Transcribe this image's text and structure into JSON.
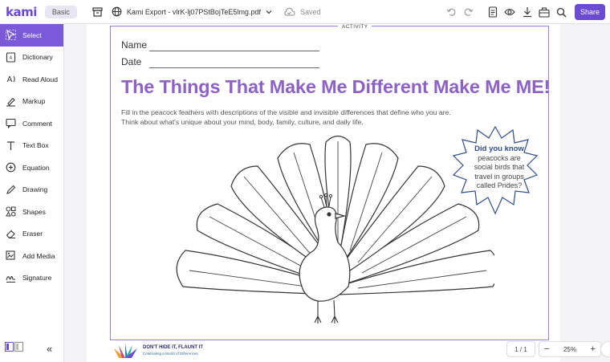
{
  "app": {
    "logo": "kami",
    "plan": "Basic",
    "filename": "Kami Export - vlrK-lj07PStBojTeE5lmg.pdf",
    "save_status": "Saved",
    "share_label": "Share"
  },
  "sidebar": {
    "tools": [
      {
        "label": "Select",
        "icon": "cursor-icon"
      },
      {
        "label": "Dictionary",
        "icon": "dictionary-icon"
      },
      {
        "label": "Read Aloud",
        "icon": "read-aloud-icon"
      },
      {
        "label": "Markup",
        "icon": "highlighter-icon"
      },
      {
        "label": "Comment",
        "icon": "comment-icon"
      },
      {
        "label": "Text Box",
        "icon": "text-icon"
      },
      {
        "label": "Equation",
        "icon": "equation-icon"
      },
      {
        "label": "Drawing",
        "icon": "pencil-icon"
      },
      {
        "label": "Shapes",
        "icon": "shapes-icon"
      },
      {
        "label": "Eraser",
        "icon": "eraser-icon"
      },
      {
        "label": "Add Media",
        "icon": "media-icon"
      },
      {
        "label": "Signature",
        "icon": "signature-icon"
      }
    ],
    "collapse_glyph": "«"
  },
  "document": {
    "activity_label": "ACTIVITY",
    "name_label": "Name",
    "date_label": "Date",
    "heading": "The Things That Make Me Different Make Me ME!",
    "instruction_1": "Fill in the peacock feathers with descriptions of the visible and invisible differences that define who you are.",
    "instruction_2": "Think about what's unique about your mind, body, family, culture, and daily life.",
    "fact_heading": "Did you know",
    "fact_lines": [
      "peacocks are",
      "social birds that",
      "travel in groups",
      "called Prides?"
    ],
    "brand_line_1": "DON'T HIDE IT, FLAUNT IT",
    "brand_line_2": "Celebrating a World of Differences"
  },
  "viewer": {
    "page_indicator": "1 / 1",
    "zoom_level": "25%",
    "zoom_out": "−",
    "zoom_in": "+"
  },
  "colors": {
    "brand": "#6b4bd1",
    "heading": "#8c63c4",
    "frame": "#9b7ed6"
  }
}
